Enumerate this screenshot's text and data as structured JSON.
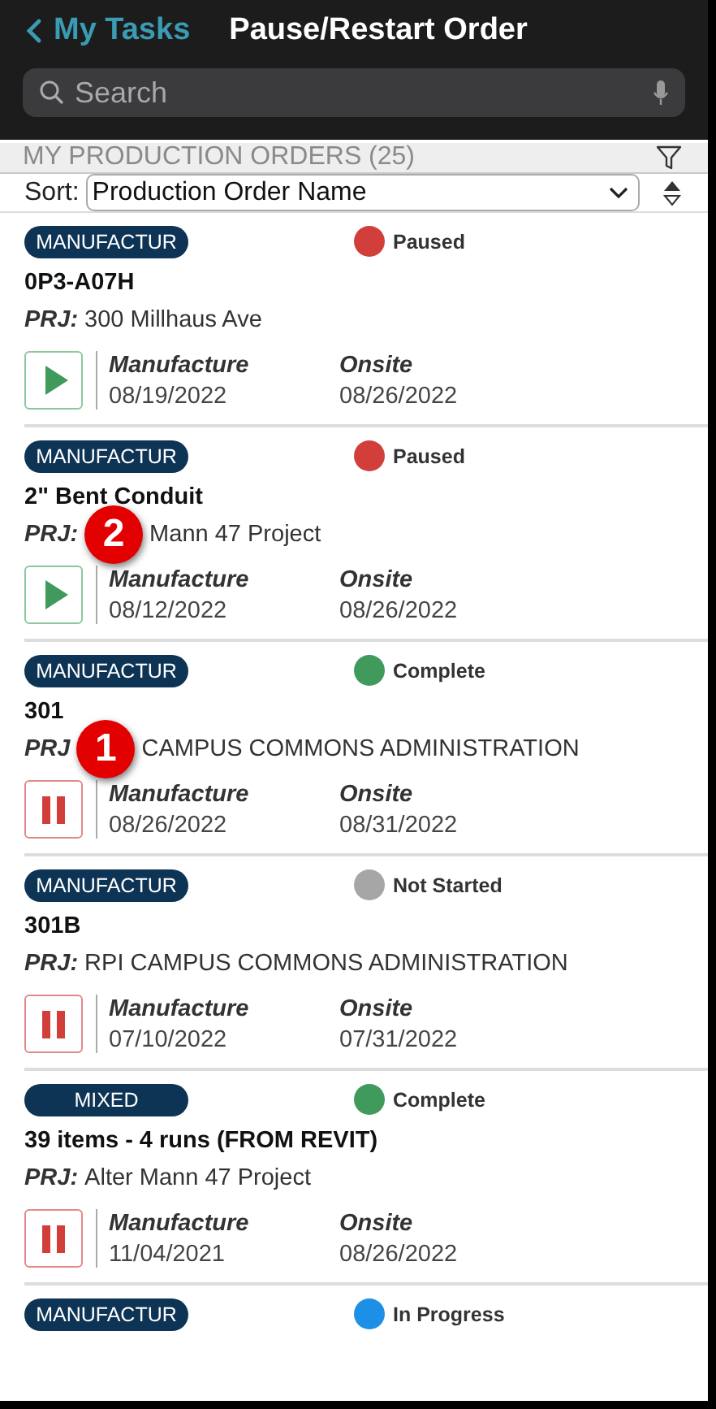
{
  "nav": {
    "back_label": "My Tasks",
    "title": "Pause/Restart Order"
  },
  "search": {
    "placeholder": "Search"
  },
  "section": {
    "title": "MY PRODUCTION ORDERS (25)"
  },
  "sort": {
    "label": "Sort:",
    "value": "Production Order Name"
  },
  "orders": [
    {
      "tag": "MANUFACTUR",
      "status": {
        "label": "Paused",
        "color": "#d23f3a"
      },
      "title": "0P3-A07H",
      "project_label": "PRJ:",
      "project": "300 Millhaus Ave",
      "kind": "play",
      "dates": [
        {
          "label": "Manufacture",
          "value": "08/19/2022"
        },
        {
          "label": "Onsite",
          "value": "08/26/2022"
        }
      ]
    },
    {
      "tag": "MANUFACTUR",
      "status": {
        "label": "Paused",
        "color": "#d23f3a"
      },
      "title": "2\" Bent Conduit",
      "project_label": "PRJ:",
      "project": "Mann 47 Project",
      "callout": "2",
      "kind": "play",
      "dates": [
        {
          "label": "Manufacture",
          "value": "08/12/2022"
        },
        {
          "label": "Onsite",
          "value": "08/26/2022"
        }
      ]
    },
    {
      "tag": "MANUFACTUR",
      "status": {
        "label": "Complete",
        "color": "#3f9a5c"
      },
      "title": "301",
      "project_label": "PRJ",
      "project": "CAMPUS COMMONS ADMINISTRATION",
      "callout": "1",
      "kind": "pause",
      "dates": [
        {
          "label": "Manufacture",
          "value": "08/26/2022"
        },
        {
          "label": "Onsite",
          "value": "08/31/2022"
        }
      ]
    },
    {
      "tag": "MANUFACTUR",
      "status": {
        "label": "Not Started",
        "color": "#a6a6a6"
      },
      "title": "301B",
      "project_label": "PRJ:",
      "project": "RPI CAMPUS COMMONS ADMINISTRATION",
      "kind": "pause",
      "dates": [
        {
          "label": "Manufacture",
          "value": "07/10/2022"
        },
        {
          "label": "Onsite",
          "value": "07/31/2022"
        }
      ]
    },
    {
      "tag": "MIXED",
      "status": {
        "label": "Complete",
        "color": "#3f9a5c"
      },
      "title": "39 items - 4 runs (FROM REVIT)",
      "project_label": "PRJ:",
      "project": "Alter Mann 47 Project",
      "kind": "pause",
      "dates": [
        {
          "label": "Manufacture",
          "value": "11/04/2021"
        },
        {
          "label": "Onsite",
          "value": "08/26/2022"
        }
      ]
    },
    {
      "tag": "MANUFACTUR",
      "status": {
        "label": "In Progress",
        "color": "#1e8fe6"
      }
    }
  ]
}
